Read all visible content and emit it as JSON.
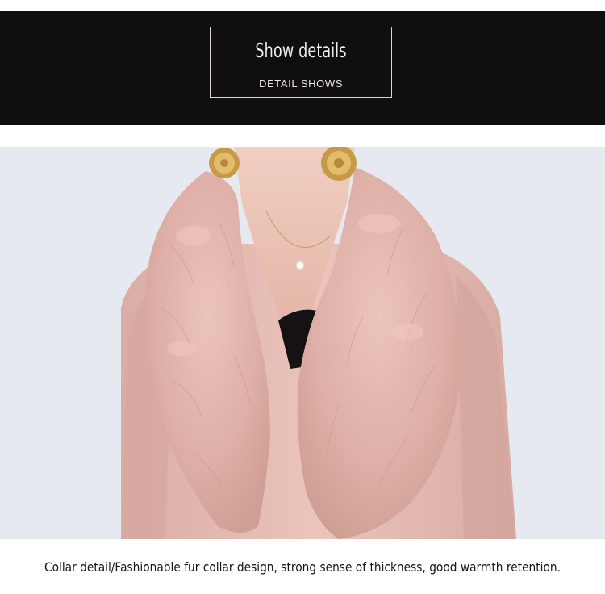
{
  "header": {
    "title": "Show details",
    "subtitle": "DETAIL SHOWS"
  },
  "photo": {
    "subject": "pink coat with fur collar",
    "colors": {
      "background": "#e6eaf0",
      "coat": "#e6bdb6",
      "fur": "#dfb3ab",
      "inner_top": "#151113",
      "skin": "#edc7b9",
      "earring": "#c89a4a"
    }
  },
  "caption": {
    "text": "Collar detail/Fashionable fur collar design, strong sense of thickness, good warmth retention."
  }
}
